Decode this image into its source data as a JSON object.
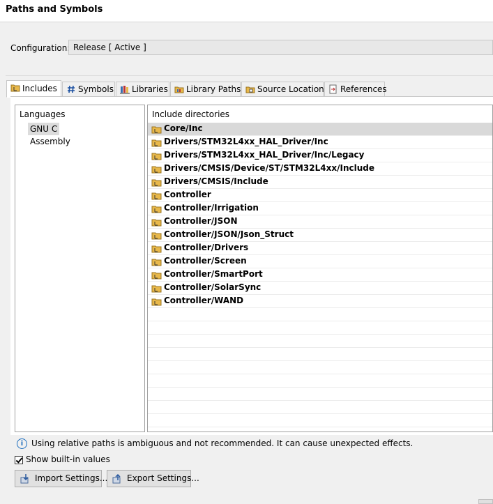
{
  "window": {
    "title": "Paths and Symbols"
  },
  "configuration": {
    "label": "Configuration:",
    "value": "Release  [ Active ]"
  },
  "tabs": [
    {
      "label": "Includes",
      "icon": "folder-include-icon",
      "active": true
    },
    {
      "label": "Symbols",
      "icon": "hash-icon",
      "active": false
    },
    {
      "label": "Libraries",
      "icon": "books-icon",
      "active": false
    },
    {
      "label": "Library Paths",
      "icon": "folder-books-icon",
      "active": false
    },
    {
      "label": "Source Location",
      "icon": "folder-source-icon",
      "active": false
    },
    {
      "label": "References",
      "icon": "references-icon",
      "active": false
    }
  ],
  "languages": {
    "header": "Languages",
    "items": [
      {
        "label": "GNU C",
        "selected": true
      },
      {
        "label": "Assembly",
        "selected": false
      }
    ]
  },
  "include_directories": {
    "header": "Include directories",
    "items": [
      "Core/Inc",
      "Drivers/STM32L4xx_HAL_Driver/Inc",
      "Drivers/STM32L4xx_HAL_Driver/Inc/Legacy",
      "Drivers/CMSIS/Device/ST/STM32L4xx/Include",
      "Drivers/CMSIS/Include",
      "Controller",
      "Controller/Irrigation",
      "Controller/JSON",
      "Controller/JSON/Json_Struct",
      "Controller/Drivers",
      "Controller/Screen",
      "Controller/SmartPort",
      "Controller/SolarSync",
      "Controller/WAND"
    ],
    "selected_index": 0
  },
  "info_message": "Using relative paths is ambiguous and not recommended. It can cause unexpected effects.",
  "show_builtin": {
    "label": "Show built-in values",
    "checked": true
  },
  "buttons": {
    "import": "Import Settings...",
    "export": "Export Settings..."
  },
  "colors": {
    "selection": "#d9d9d9",
    "info_blue": "#1e6fbf",
    "folder_yellow": "#e8b84a"
  }
}
